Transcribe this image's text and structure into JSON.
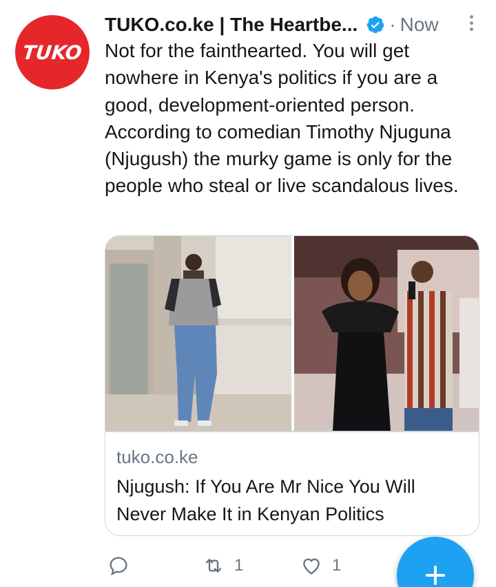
{
  "tweet": {
    "avatar_text": "TUKO",
    "author": "TUKO.co.ke | The Heartbe...",
    "separator": "·",
    "time": "Now",
    "text": "Not for the fainthearted. You will get nowhere in Kenya's politics if you are a good, development-oriented person. According to comedian Timothy Njuguna (Njugush) the murky game is only for the people who steal or live scandalous lives.",
    "verified_icon": "verified-badge-icon",
    "more_icon": "more-vertical-icon"
  },
  "card": {
    "domain": "tuko.co.ke",
    "title": "Njugush: If You Are Mr Nice You Will Never Make It in Kenyan Politics"
  },
  "actions": {
    "reply_icon": "reply-icon",
    "retweet_icon": "retweet-icon",
    "retweet_count": "1",
    "like_icon": "heart-icon",
    "like_count": "1"
  },
  "fab": {
    "icon": "plus-icon"
  },
  "colors": {
    "brand_red": "#e5272c",
    "twitter_blue": "#1da1f2",
    "secondary_text": "#657786",
    "primary_text": "#14171a",
    "border": "#ccd6dd"
  }
}
